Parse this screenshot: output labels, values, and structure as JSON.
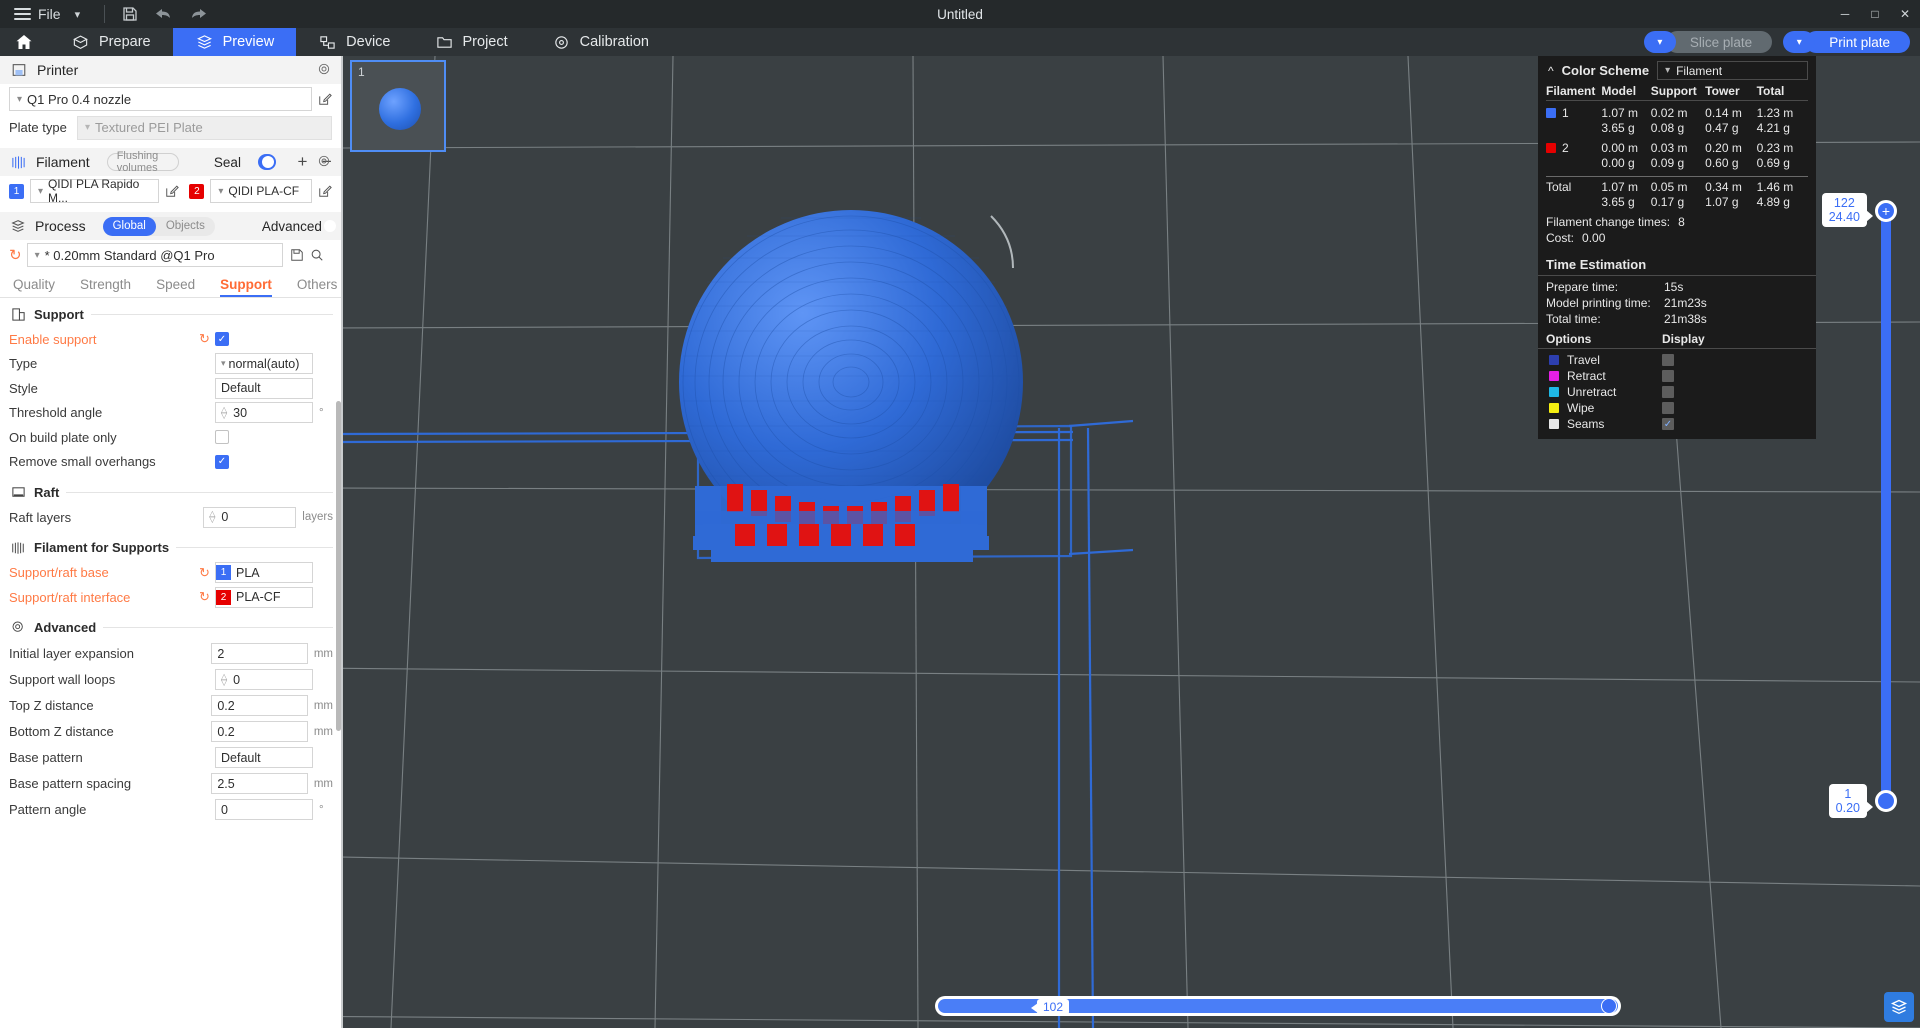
{
  "titlebar": {
    "file_label": "File",
    "title": "Untitled",
    "icons": [
      "save-icon",
      "undo-icon",
      "redo-icon"
    ],
    "window_buttons": [
      "minimize",
      "maximize",
      "close"
    ]
  },
  "navtabs": [
    {
      "label": "Prepare",
      "icon": "cube-icon",
      "active": false
    },
    {
      "label": "Preview",
      "icon": "layers-icon",
      "active": true
    },
    {
      "label": "Device",
      "icon": "device-icon",
      "active": false
    },
    {
      "label": "Project",
      "icon": "folder-icon",
      "active": false
    },
    {
      "label": "Calibration",
      "icon": "target-icon",
      "active": false
    }
  ],
  "plate_actions": {
    "slice_label": "Slice plate",
    "print_label": "Print plate"
  },
  "printer": {
    "section_label": "Printer",
    "model": "Q1 Pro 0.4 nozzle",
    "plate_type_label": "Plate type",
    "plate_type_value": "Textured PEI Plate"
  },
  "filament": {
    "section_label": "Filament",
    "flushing_label": "Flushing volumes",
    "seal_label": "Seal",
    "seal_on": true,
    "slots": [
      {
        "index": "1",
        "color": "#3b6ef5",
        "name": "QIDI PLA Rapido M..."
      },
      {
        "index": "2",
        "color": "#e60000",
        "name": "QIDI PLA-CF"
      }
    ]
  },
  "process": {
    "section_label": "Process",
    "seg_global": "Global",
    "seg_objects": "Objects",
    "advanced_label": "Advanced",
    "advanced_on": true,
    "preset": "* 0.20mm Standard @Q1 Pro",
    "tabs": [
      "Quality",
      "Strength",
      "Speed",
      "Support",
      "Others"
    ],
    "active_tab": "Support"
  },
  "support_group": {
    "title": "Support",
    "rows": [
      {
        "label": "Enable support",
        "modified": true,
        "undo": true,
        "type": "checkbox",
        "value": true
      },
      {
        "label": "Type",
        "type": "combo",
        "value": "normal(auto)"
      },
      {
        "label": "Style",
        "type": "text",
        "value": "Default"
      },
      {
        "label": "Threshold angle",
        "type": "spinner",
        "value": "30",
        "unit": "°"
      },
      {
        "label": "On build plate only",
        "type": "checkbox",
        "value": false
      },
      {
        "label": "Remove small overhangs",
        "type": "checkbox",
        "value": true
      }
    ]
  },
  "raft_group": {
    "title": "Raft",
    "rows": [
      {
        "label": "Raft layers",
        "type": "spinner",
        "value": "0",
        "unit": "layers"
      }
    ]
  },
  "filament_supports_group": {
    "title": "Filament for Supports",
    "rows": [
      {
        "label": "Support/raft base",
        "modified": true,
        "undo": true,
        "type": "filament",
        "badge": "1",
        "badge_color": "#3b6ef5",
        "value": "PLA"
      },
      {
        "label": "Support/raft interface",
        "modified": true,
        "undo": true,
        "type": "filament",
        "badge": "2",
        "badge_color": "#e60000",
        "value": "PLA-CF"
      }
    ]
  },
  "advanced_group": {
    "title": "Advanced",
    "rows": [
      {
        "label": "Initial layer expansion",
        "type": "text",
        "value": "2",
        "unit": "mm"
      },
      {
        "label": "Support wall loops",
        "type": "spinner",
        "value": "0",
        "unit": ""
      },
      {
        "label": "Top Z distance",
        "type": "text",
        "value": "0.2",
        "unit": "mm"
      },
      {
        "label": "Bottom Z distance",
        "type": "text",
        "value": "0.2",
        "unit": "mm"
      },
      {
        "label": "Base pattern",
        "type": "text",
        "value": "Default",
        "unit": ""
      },
      {
        "label": "Base pattern spacing",
        "type": "text",
        "value": "2.5",
        "unit": "mm"
      },
      {
        "label": "Pattern angle",
        "type": "text",
        "value": "0",
        "unit": "°"
      }
    ]
  },
  "viewport": {
    "plate_number": "1"
  },
  "legend": {
    "title": "Color Scheme",
    "scheme_value": "Filament",
    "headers": [
      "Filament",
      "Model",
      "Support",
      "Tower",
      "Total"
    ],
    "rows": [
      {
        "label": "1",
        "color": "#3b6ef5",
        "model_m": "1.07 m",
        "model_g": "3.65 g",
        "support_m": "0.02 m",
        "support_g": "0.08 g",
        "tower_m": "0.14 m",
        "tower_g": "0.47 g",
        "total_m": "1.23 m",
        "total_g": "4.21 g"
      },
      {
        "label": "2",
        "color": "#e60000",
        "model_m": "0.00 m",
        "model_g": "0.00 g",
        "support_m": "0.03 m",
        "support_g": "0.09 g",
        "tower_m": "0.20 m",
        "tower_g": "0.60 g",
        "total_m": "0.23 m",
        "total_g": "0.69 g"
      }
    ],
    "total_row": {
      "label": "Total",
      "model_m": "1.07 m",
      "model_g": "3.65 g",
      "support_m": "0.05 m",
      "support_g": "0.17 g",
      "tower_m": "0.34 m",
      "tower_g": "1.07 g",
      "total_m": "1.46 m",
      "total_g": "4.89 g"
    },
    "change_times_label": "Filament change times:",
    "change_times_value": "8",
    "cost_label": "Cost:",
    "cost_value": "0.00",
    "time_section": "Time Estimation",
    "prepare_label": "Prepare time:",
    "prepare_value": "15s",
    "model_print_label": "Model printing time:",
    "model_print_value": "21m23s",
    "total_time_label": "Total time:",
    "total_time_value": "21m38s",
    "options_label": "Options",
    "display_label": "Display",
    "options": [
      {
        "label": "Travel",
        "color": "#2d3fb0",
        "checked": false
      },
      {
        "label": "Retract",
        "color": "#e51fe5",
        "checked": false
      },
      {
        "label": "Unretract",
        "color": "#1fb8e5",
        "checked": false
      },
      {
        "label": "Wipe",
        "color": "#f5ef12",
        "checked": false
      },
      {
        "label": "Seams",
        "color": "#e8e8e8",
        "checked": true
      }
    ]
  },
  "sliders": {
    "vertical_top_layer": "122",
    "vertical_top_height": "24.40",
    "vertical_bottom_layer": "1",
    "vertical_bottom_height": "0.20",
    "horizontal_value": "102"
  }
}
